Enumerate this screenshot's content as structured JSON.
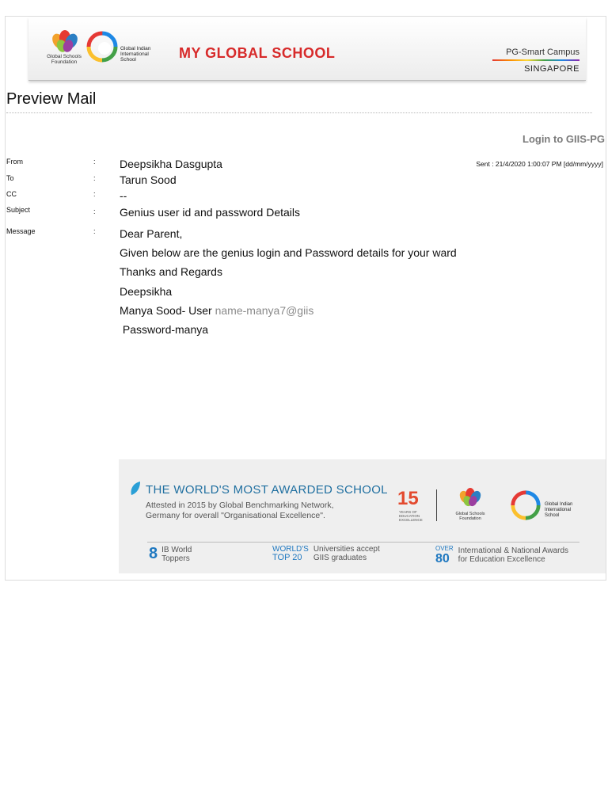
{
  "header": {
    "gsf_name": "Global Schools Foundation",
    "giis_name": "Global Indian International School",
    "brand_title": "MY GLOBAL SCHOOL",
    "campus": "PG-Smart Campus",
    "campus_location": "SINGAPORE"
  },
  "page_title": "Preview Mail",
  "login_link": "Login to GIIS-PG",
  "mail": {
    "from_label": "From",
    "to_label": "To",
    "cc_label": "CC",
    "subject_label": "Subject",
    "message_label": "Message",
    "colon": ":",
    "from": "Deepsikha Dasgupta",
    "to": "Tarun Sood",
    "cc": "--",
    "subject": "Genius user id and password Details",
    "sent": "Sent  :  21/4/2020 1:00:07 PM [dd/mm/yyyy]",
    "body": {
      "greeting": "Dear Parent,",
      "line1": "Given below are the genius login and Password details for your ward",
      "regards": "Thanks and Regards",
      "signature": "Deepsikha",
      "user_prefix": "Manya Sood-  User ",
      "user_id": "name-manya7@giis",
      "password": " Password-manya"
    }
  },
  "award": {
    "headline": "THE WORLD'S MOST AWARDED SCHOOL",
    "sub_line1": "Attested in 2015 by Global Benchmarking Network,",
    "sub_line2": "Germany for overall \"Organisational Excellence\".",
    "years": "15",
    "years_sub": "YEARS OF EDUCATION EXCELLENCE",
    "gsf_name": "Global Schools Foundation",
    "giis_name": "Global Indian International School",
    "stat1_big": "8",
    "stat1_text": "IB World Toppers",
    "stat2_small1": "WORLD'S",
    "stat2_small2": "TOP 20",
    "stat2_text1": "Universities accept",
    "stat2_text2": "GIIS graduates",
    "stat3_small1": "OVER",
    "stat3_big": "80",
    "stat3_text1": "International & National Awards",
    "stat3_text2": "for Education Excellence"
  }
}
